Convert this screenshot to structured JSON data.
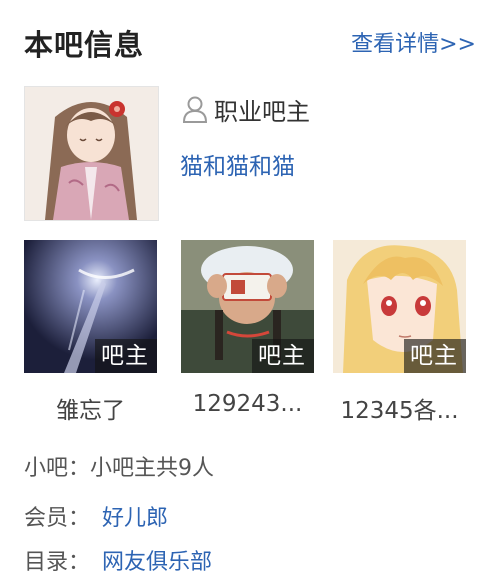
{
  "header": {
    "title": "本吧信息",
    "more_link": "查看详情>>"
  },
  "owner": {
    "role_label": "职业吧主",
    "role_icon": "user-outline-icon",
    "name": "猫和猫和猫"
  },
  "assistants": [
    {
      "badge": "吧主",
      "name": "雏忘了"
    },
    {
      "badge": "吧主",
      "name": "129243..."
    },
    {
      "badge": "吧主",
      "name": "12345各..."
    }
  ],
  "info": {
    "small_owner_label": "小吧：",
    "small_owner_value": "小吧主共9人",
    "member_label": "会员：",
    "member_value": "好儿郎",
    "catalog_label": "目录：",
    "catalog_value": "网友俱乐部"
  },
  "colors": {
    "link": "#2d64b3",
    "title": "#222222",
    "badge_bg": "#141414"
  }
}
